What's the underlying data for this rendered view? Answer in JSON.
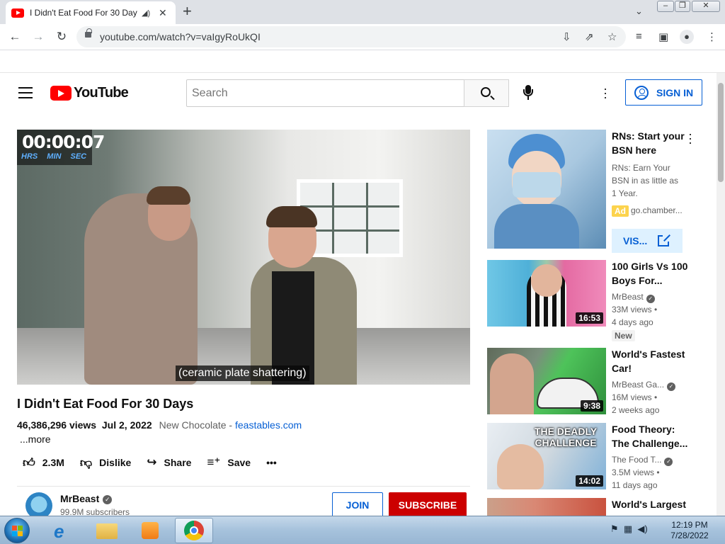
{
  "browser": {
    "tab_title": "I Didn't Eat Food For 30 Days - YouTube",
    "new_tab_icon": "plus-icon",
    "url": "youtube.com/watch?v=vaIgyRoUkQI"
  },
  "masthead": {
    "logo_text": "YouTube",
    "search_placeholder": "Search",
    "sign_in_label": "SIGN IN"
  },
  "player": {
    "timer": "00:00:07",
    "timer_units": "HRS MIN SEC",
    "caption": "(ceramic plate shattering)"
  },
  "video": {
    "title": "I Didn't Eat Food For 30 Days",
    "views": "46,386,296 views",
    "date": "Jul 2, 2022",
    "description_text": "New Chocolate - ",
    "description_link": "feastables.com",
    "more_label": "...more",
    "likes": "2.3M",
    "dislike_label": "Dislike",
    "share_label": "Share",
    "save_label": "Save"
  },
  "channel": {
    "name": "MrBeast",
    "subscribers": "99.9M subscribers",
    "join_label": "JOIN",
    "subscribe_label": "SUBSCRIBE"
  },
  "ad": {
    "title": "RNs: Start your BSN here",
    "body": "RNs: Earn Your BSN in as little as 1 Year.",
    "badge": "Ad",
    "domain": "go.chamber...",
    "visit_label": "VIS..."
  },
  "related": [
    {
      "title": "100 Girls Vs 100 Boys For...",
      "channel": "MrBeast",
      "views": "33M views •",
      "age": "4 days ago",
      "duration": "16:53",
      "badge": "New"
    },
    {
      "title": "World's Fastest Car!",
      "channel": "MrBeast Ga...",
      "views": "16M views •",
      "age": "2 weeks ago",
      "duration": "9:38"
    },
    {
      "title": "Food Theory: The Challenge...",
      "channel": "The Food T...",
      "views": "3.5M views •",
      "age": "11 days ago",
      "duration": "14:02",
      "thumb_text": "THE DEADLY CHALLENGE"
    },
    {
      "title": "World's Largest"
    }
  ],
  "taskbar": {
    "time": "12:19 PM",
    "date": "7/28/2022"
  },
  "colors": {
    "youtube_red": "#ff0000",
    "link_blue": "#065fd4",
    "subscribe_red": "#cc0000",
    "ad_yellow": "#fcd34d"
  }
}
